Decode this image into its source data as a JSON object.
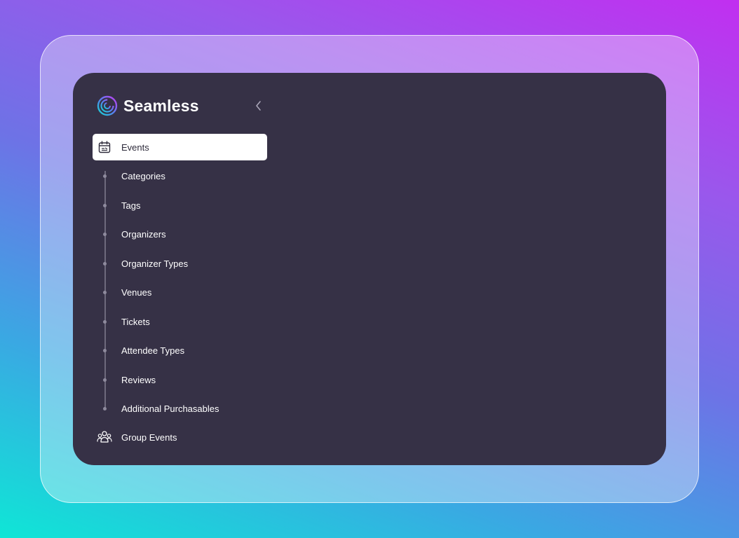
{
  "app": {
    "name": "Seamless"
  },
  "sidebar": {
    "active_item": {
      "label": "Events",
      "icon": "calendar-icon"
    },
    "sub_items": [
      {
        "label": "Categories"
      },
      {
        "label": "Tags"
      },
      {
        "label": "Organizers"
      },
      {
        "label": "Organizer Types"
      },
      {
        "label": "Venues"
      },
      {
        "label": "Tickets"
      },
      {
        "label": "Attendee Types"
      },
      {
        "label": "Reviews"
      },
      {
        "label": "Additional Purchasables"
      }
    ],
    "group_item": {
      "label": "Group Events",
      "icon": "group-icon"
    },
    "collapse_icon": "chevron-left-icon"
  },
  "colors": {
    "panel_bg": "#363146",
    "active_bg": "#ffffff",
    "text": "#ffffff",
    "active_text": "#2d2a3a"
  }
}
